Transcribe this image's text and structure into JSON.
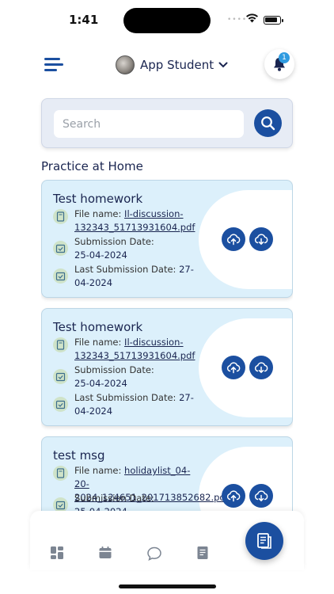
{
  "status": {
    "time": "1:41",
    "signal": "••••"
  },
  "header": {
    "profile_name": "App Student",
    "notification_count": "1"
  },
  "search": {
    "placeholder": "Search"
  },
  "section": {
    "title": "Practice at Home"
  },
  "labels": {
    "file_name": "File name:",
    "submission_date": "Submission Date:",
    "last_submission_date": "Last Submission Date:"
  },
  "homework": [
    {
      "title": "Test homework",
      "file_name": "Il-discussion-132343_51713931604.pdf",
      "submission_date": "25-04-2024",
      "last_submission_date": "27-04-2024"
    },
    {
      "title": "Test homework",
      "file_name": "Il-discussion-132343_51713931604.pdf",
      "submission_date": "25-04-2024",
      "last_submission_date": "27-04-2024"
    },
    {
      "title": "test msg",
      "file_name": "holidaylist_04-20-2024_124651_201713852682.pdf",
      "submission_date": "25-04-2024",
      "last_submission_date": ""
    }
  ],
  "bottom_nav": [
    "dashboard-icon",
    "calendar-icon",
    "chat-icon",
    "report-icon"
  ],
  "colors": {
    "primary": "#1b4fa0",
    "card_bg": "#dcf0fb",
    "search_bg": "#e7ecf5",
    "text": "#1a2550"
  }
}
